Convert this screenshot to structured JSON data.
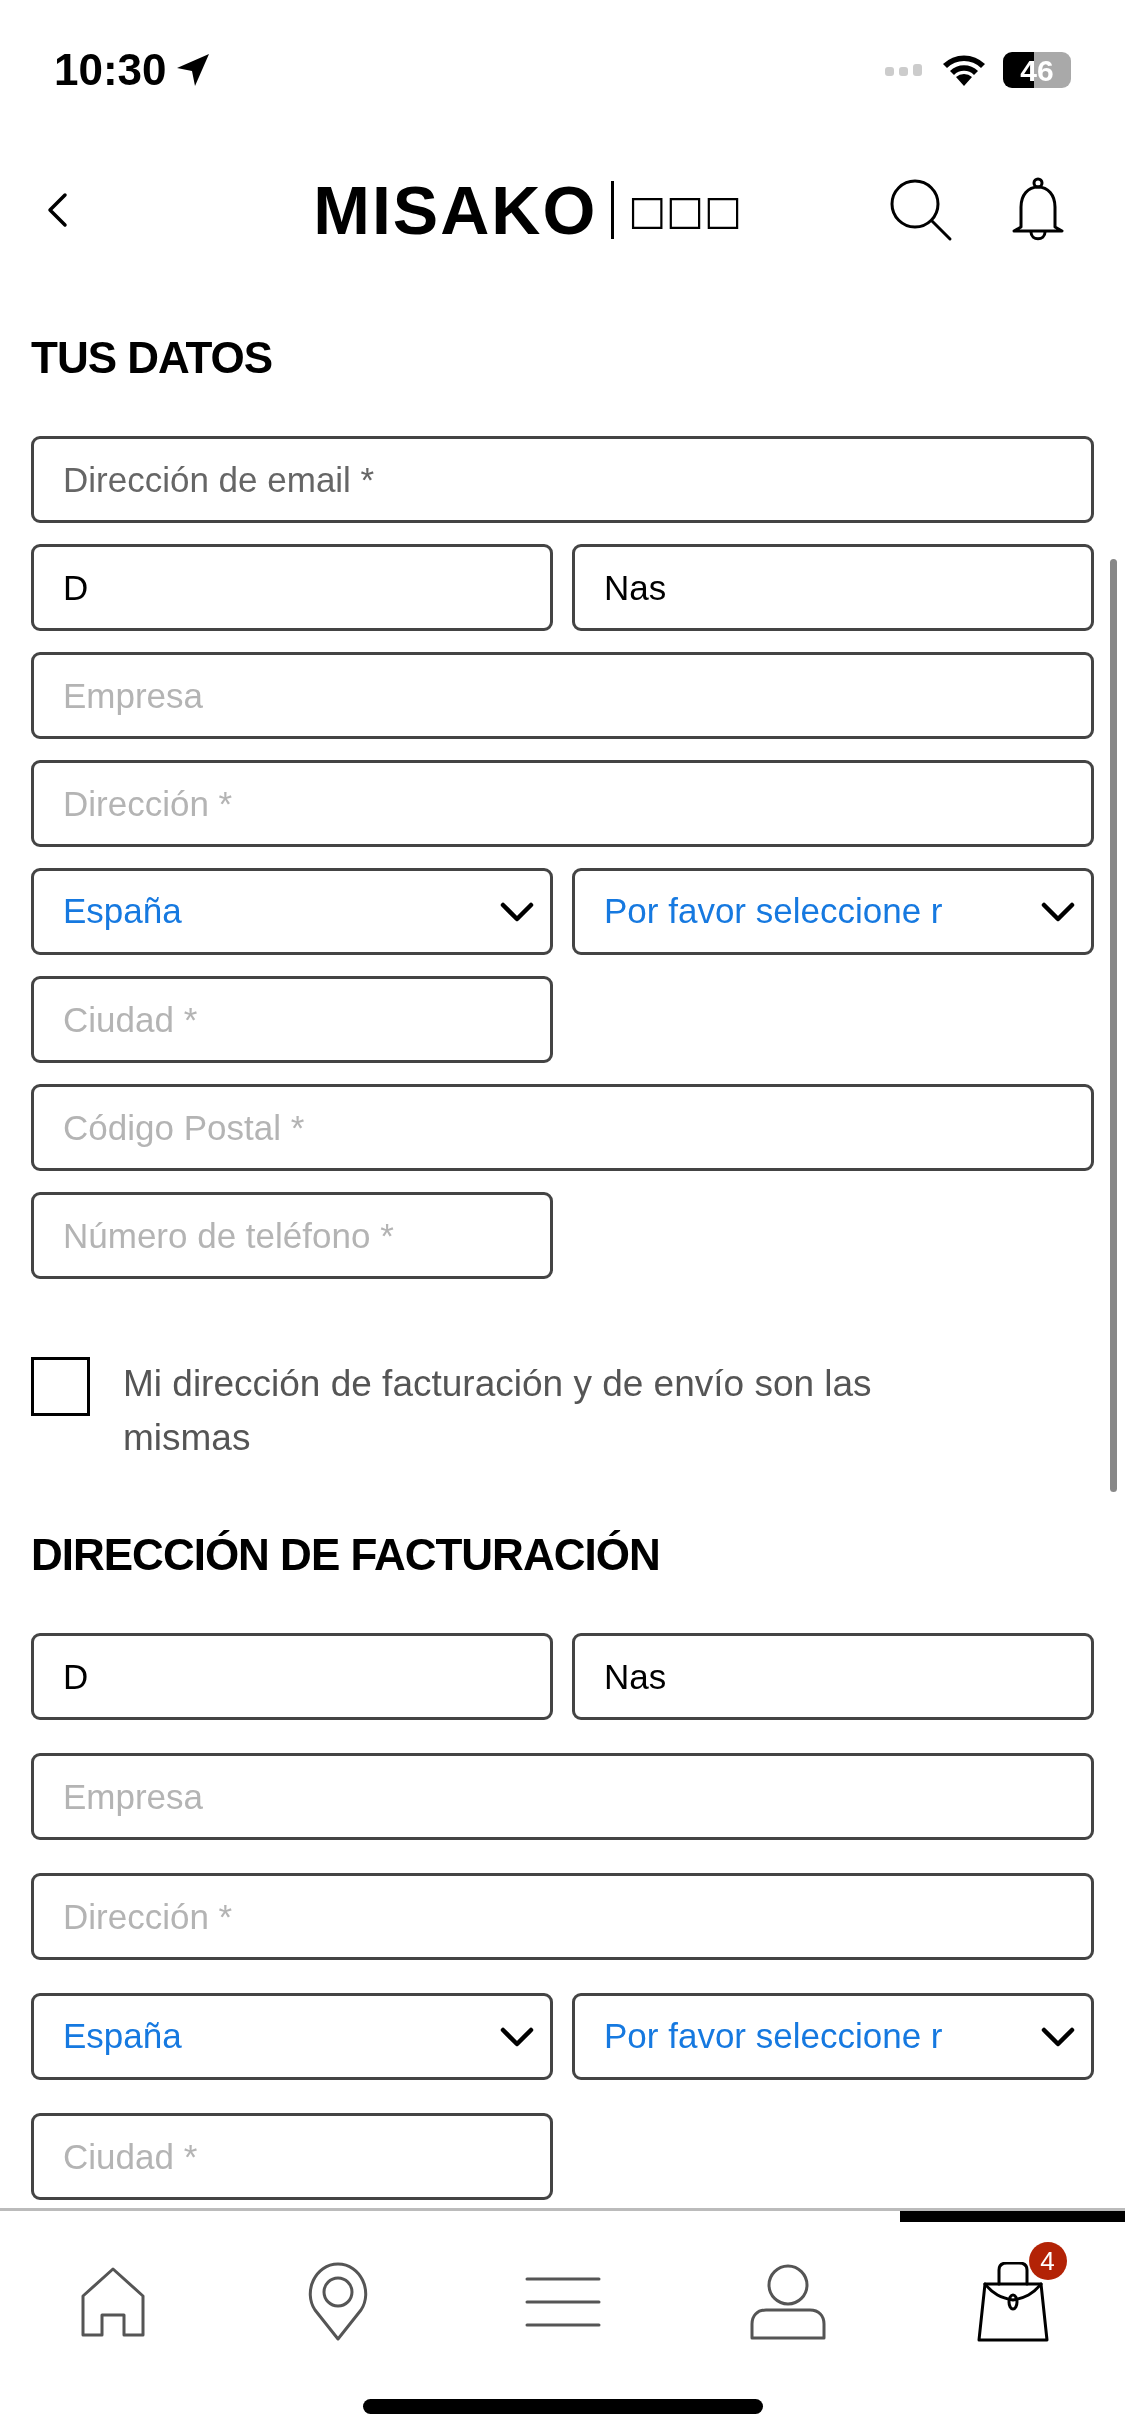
{
  "status_bar": {
    "time": "10:30",
    "battery": "46"
  },
  "header": {
    "logo": "MISAKO",
    "logo_suffix": "□□□"
  },
  "sections": [
    {
      "title": "TUS DATOS",
      "rows": [
        [
          {
            "kind": "full-input",
            "placeholder": "Dirección de email *",
            "strong": true
          }
        ],
        [
          {
            "kind": "half-input",
            "value": "D"
          },
          {
            "kind": "half-input",
            "value": "Nas"
          }
        ],
        [
          {
            "kind": "full-input",
            "placeholder": "Empresa",
            "strong": false
          }
        ],
        [
          {
            "kind": "full-input",
            "placeholder": "Dirección *",
            "strong": false
          }
        ],
        [
          {
            "kind": "half-select",
            "value": "España"
          },
          {
            "kind": "half-select",
            "value": "Por favor seleccione r"
          }
        ],
        [
          {
            "kind": "half-input",
            "placeholder": "Ciudad *",
            "strong": false
          }
        ],
        [
          {
            "kind": "full-input",
            "placeholder": "Código Postal *",
            "strong": false
          }
        ],
        [
          {
            "kind": "half-input",
            "placeholder": "Número de teléfono *",
            "strong": false
          }
        ]
      ],
      "checkbox": {
        "label": "Mi dirección de facturación y de envío son las mismas",
        "checked": false
      }
    },
    {
      "title": "DIRECCIÓN DE FACTURACIÓN",
      "rows": [
        [
          {
            "kind": "half-input",
            "value": "D"
          },
          {
            "kind": "half-input",
            "value": "Nas"
          }
        ],
        [
          {
            "kind": "full-input",
            "placeholder": "Empresa",
            "strong": false
          }
        ],
        [
          {
            "kind": "full-input",
            "placeholder": "Dirección *",
            "strong": false
          }
        ],
        [
          {
            "kind": "half-select",
            "value": "España"
          },
          {
            "kind": "half-select",
            "value": "Por favor seleccione r"
          }
        ],
        [
          {
            "kind": "half-input",
            "placeholder": "Ciudad *",
            "strong": false
          }
        ]
      ]
    }
  ],
  "tab_bar": [
    {
      "selected": false
    },
    {
      "selected": false
    },
    {
      "selected": false
    },
    {
      "selected": false
    },
    {
      "selected": true,
      "badge": "4"
    }
  ]
}
